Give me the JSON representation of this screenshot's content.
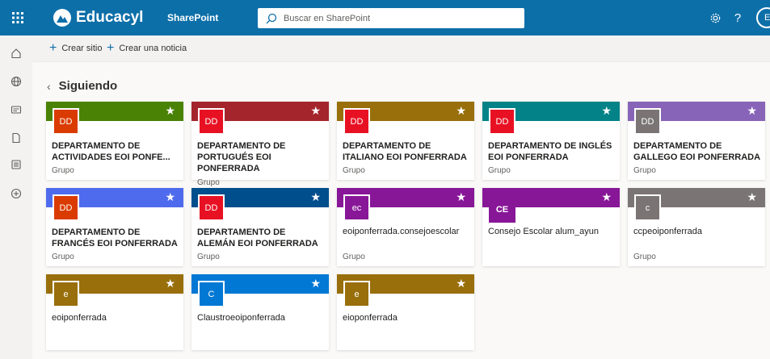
{
  "header": {
    "brand_name": "Educacyl",
    "app_name": "SharePoint",
    "search_placeholder": "Buscar en SharePoint",
    "avatar_initial": "E",
    "bar_color": "#0d6fa8"
  },
  "commands": {
    "create_site": "Crear sitio",
    "create_news": "Crear una noticia"
  },
  "page": {
    "title": "Siguiendo"
  },
  "sites": [
    {
      "initials": "DD",
      "title": "DEPARTAMENTO DE ACTIVIDADES EOI PONFE...",
      "type": "Grupo",
      "banner_color": "#498205",
      "logo_color": "#da3b01",
      "caps": true
    },
    {
      "initials": "DD",
      "title": "DEPARTAMENTO DE PORTUGUÉS EOI PONFERRADA",
      "type": "Grupo",
      "banner_color": "#a4262c",
      "logo_color": "#e81123",
      "caps": true
    },
    {
      "initials": "DD",
      "title": "DEPARTAMENTO DE ITALIANO EOI PONFERRADA",
      "type": "Grupo",
      "banner_color": "#986f0b",
      "logo_color": "#e81123",
      "caps": true
    },
    {
      "initials": "DD",
      "title": "DEPARTAMENTO DE INGLÉS EOI PONFERRADA",
      "type": "Grupo",
      "banner_color": "#038387",
      "logo_color": "#e81123",
      "caps": true
    },
    {
      "initials": "DD",
      "title": "DEPARTAMENTO DE GALLEGO EOI PONFERRADA",
      "type": "Grupo",
      "banner_color": "#8764b8",
      "logo_color": "#7a7574",
      "caps": true
    },
    {
      "initials": "DD",
      "title": "DEPARTAMENTO DE FRANCÉS EOI PONFERRADA",
      "type": "Grupo",
      "banner_color": "#4f6bed",
      "logo_color": "#da3b01",
      "caps": true
    },
    {
      "initials": "DD",
      "title": "DEPARTAMENTO DE ALEMÁN EOI PONFERRADA",
      "type": "Grupo",
      "banner_color": "#004e8c",
      "logo_color": "#e81123",
      "caps": true
    },
    {
      "initials": "ec",
      "title": "eoiponferrada.consejoescolar",
      "type": "Grupo",
      "banner_color": "#881798",
      "logo_color": "#881798",
      "caps": false
    },
    {
      "initials": "CE",
      "title": "Consejo Escolar alum_ayun",
      "type": "",
      "banner_color": "#881798",
      "logo_color": "#881798",
      "caps": false
    },
    {
      "initials": "c",
      "title": "ccpeoiponferrada",
      "type": "Grupo",
      "banner_color": "#7a7574",
      "logo_color": "#7a7574",
      "caps": false
    },
    {
      "initials": "e",
      "title": "eoiponferrada",
      "type": "",
      "banner_color": "#986f0b",
      "logo_color": "#986f0b",
      "caps": false
    },
    {
      "initials": "C",
      "title": "Claustroeoiponferrada",
      "type": "",
      "banner_color": "#0078d4",
      "logo_color": "#0078d4",
      "caps": false
    },
    {
      "initials": "e",
      "title": "eioponferrada",
      "type": "",
      "banner_color": "#986f0b",
      "logo_color": "#986f0b",
      "caps": false
    }
  ]
}
